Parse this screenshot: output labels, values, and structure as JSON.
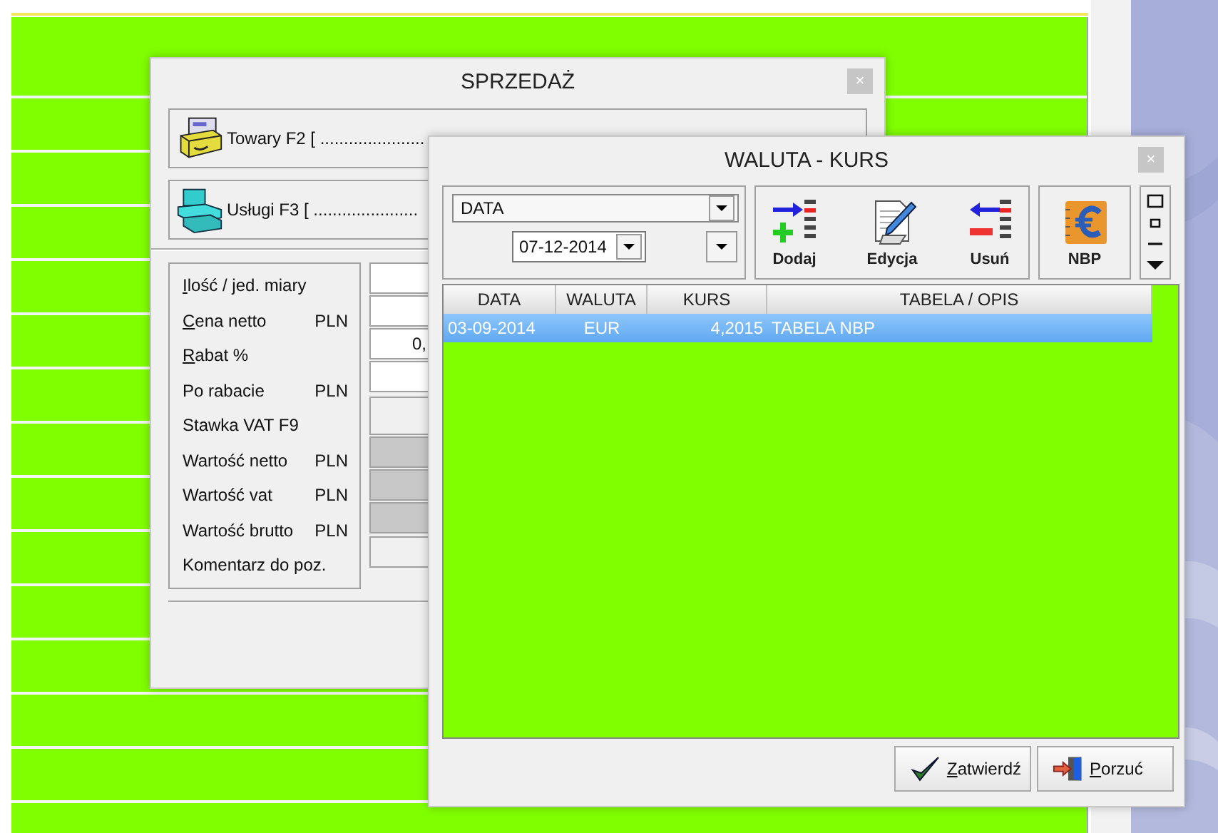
{
  "sales_window": {
    "title": "SPRZEDAŻ",
    "close": "×",
    "sources": [
      {
        "kind": "goods",
        "label": "Towary  F2 [ ......................"
      },
      {
        "kind": "services",
        "label": "Usługi  F3 [ ......................"
      }
    ],
    "fields": [
      {
        "label": "Ilość / jed. miary",
        "underline_first": true,
        "kind": "input"
      },
      {
        "label": "Cena netto",
        "underline_first": true,
        "unit": "PLN",
        "kind": "input"
      },
      {
        "label": "Rabat %",
        "underline_first": true,
        "kind": "input",
        "value": "0,"
      },
      {
        "label": "Po rabacie",
        "underline_first": false,
        "unit": "PLN",
        "kind": "input"
      },
      {
        "label": "Stawka VAT F9",
        "underline_first": false,
        "kind": "select"
      },
      {
        "label": "Wartość netto",
        "underline_first": false,
        "unit": "PLN",
        "kind": "readonly"
      },
      {
        "label": "Wartość vat",
        "underline_first": false,
        "unit": "PLN",
        "kind": "readonly"
      },
      {
        "label": "Wartość brutto",
        "underline_first": false,
        "unit": "PLN",
        "kind": "readonly"
      },
      {
        "label": "Komentarz do poz.",
        "underline_first": false,
        "kind": "select"
      }
    ]
  },
  "rate_window": {
    "title": "WALUTA - KURS",
    "close": "×",
    "filter": {
      "value": "DATA",
      "date": "07-12-2014"
    },
    "tools": [
      {
        "kind": "add",
        "label": "Dodaj"
      },
      {
        "kind": "edit",
        "label": "Edycja"
      },
      {
        "kind": "remove",
        "label": "Usuń"
      }
    ],
    "nbp": {
      "label": "NBP"
    },
    "table": {
      "columns": [
        "DATA",
        "WALUTA",
        "KURS",
        "TABELA / OPIS"
      ],
      "rows": [
        {
          "cells": [
            "03-09-2014",
            "EUR",
            "4,2015",
            "TABELA NBP"
          ],
          "selected": true
        }
      ]
    },
    "buttons": [
      {
        "kind": "confirm",
        "label": "Zatwierdź",
        "underline_first": true
      },
      {
        "kind": "cancel",
        "label": "Porzuć",
        "underline_first": true
      }
    ]
  }
}
